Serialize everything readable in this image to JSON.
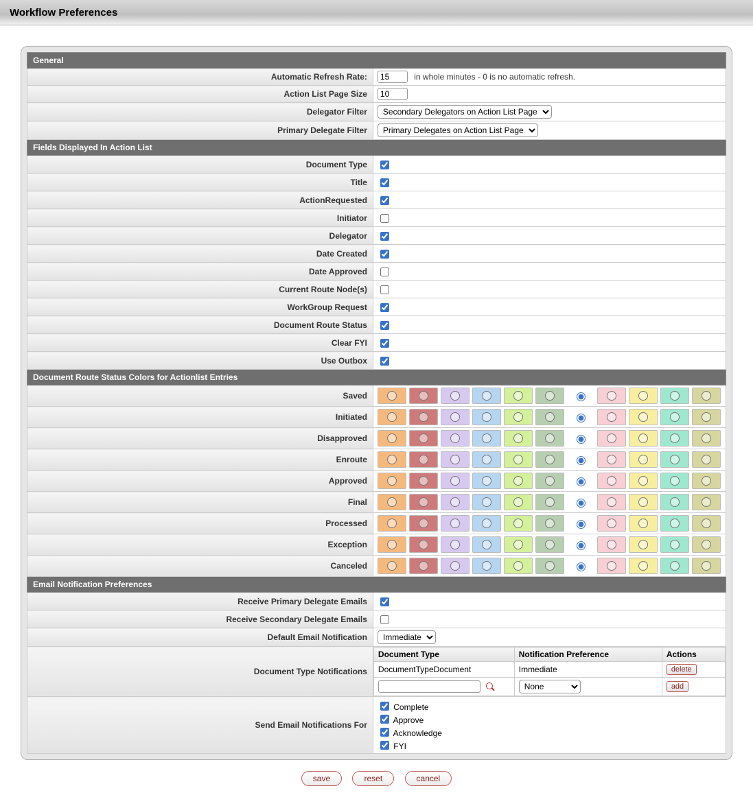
{
  "page_title": "Workflow Preferences",
  "sections": {
    "general": "General",
    "fields": "Fields Displayed In Action List",
    "colors": "Document Route Status Colors for Actionlist Entries",
    "email": "Email Notification Preferences"
  },
  "general": {
    "refresh_label": "Automatic Refresh Rate:",
    "refresh_value": "15",
    "refresh_hint": "in whole minutes - 0 is no automatic refresh.",
    "pagesize_label": "Action List Page Size",
    "pagesize_value": "10",
    "delegator_filter_label": "Delegator Filter",
    "delegator_filter_value": "Secondary Delegators on Action List Page",
    "primary_delegate_filter_label": "Primary Delegate Filter",
    "primary_delegate_filter_value": "Primary Delegates on Action List Page"
  },
  "fields": [
    {
      "label": "Document Type",
      "checked": true
    },
    {
      "label": "Title",
      "checked": true
    },
    {
      "label": "ActionRequested",
      "checked": true
    },
    {
      "label": "Initiator",
      "checked": false
    },
    {
      "label": "Delegator",
      "checked": true
    },
    {
      "label": "Date Created",
      "checked": true
    },
    {
      "label": "Date Approved",
      "checked": false
    },
    {
      "label": "Current Route Node(s)",
      "checked": false
    },
    {
      "label": "WorkGroup Request",
      "checked": true
    },
    {
      "label": "Document Route Status",
      "checked": true
    },
    {
      "label": "Clear FYI",
      "checked": true
    },
    {
      "label": "Use Outbox",
      "checked": true
    }
  ],
  "color_swatches": [
    "#f6b97d",
    "#cf7a7a",
    "#d7c8f0",
    "#b6d5f0",
    "#d4f09a",
    "#b7ceb0",
    "#ffffff",
    "#f7cfd4",
    "#f7ef9f",
    "#9ee8d0",
    "#d7d69f"
  ],
  "status_rows": [
    {
      "label": "Saved",
      "selected_index": 6
    },
    {
      "label": "Initiated",
      "selected_index": 6
    },
    {
      "label": "Disapproved",
      "selected_index": 6
    },
    {
      "label": "Enroute",
      "selected_index": 6
    },
    {
      "label": "Approved",
      "selected_index": 6
    },
    {
      "label": "Final",
      "selected_index": 6
    },
    {
      "label": "Processed",
      "selected_index": 6
    },
    {
      "label": "Exception",
      "selected_index": 6
    },
    {
      "label": "Canceled",
      "selected_index": 6
    }
  ],
  "email": {
    "primary_label": "Receive Primary Delegate Emails",
    "primary_checked": true,
    "secondary_label": "Receive Secondary Delegate Emails",
    "secondary_checked": false,
    "default_label": "Default Email Notification",
    "default_value": "Immediate",
    "doc_type_notif_label": "Document Type Notifications",
    "table_headers": {
      "doc_type": "Document Type",
      "pref": "Notification Preference",
      "actions": "Actions"
    },
    "rows": [
      {
        "doc_type": "DocumentTypeDocument",
        "pref": "Immediate",
        "action_label": "delete"
      }
    ],
    "add_row": {
      "input_value": "",
      "pref_value": "None",
      "action_label": "add"
    },
    "send_for_label": "Send Email Notifications For",
    "send_for": [
      {
        "label": "Complete",
        "checked": true
      },
      {
        "label": "Approve",
        "checked": true
      },
      {
        "label": "Acknowledge",
        "checked": true
      },
      {
        "label": "FYI",
        "checked": true
      }
    ]
  },
  "buttons": {
    "save": "save",
    "reset": "reset",
    "cancel": "cancel"
  }
}
